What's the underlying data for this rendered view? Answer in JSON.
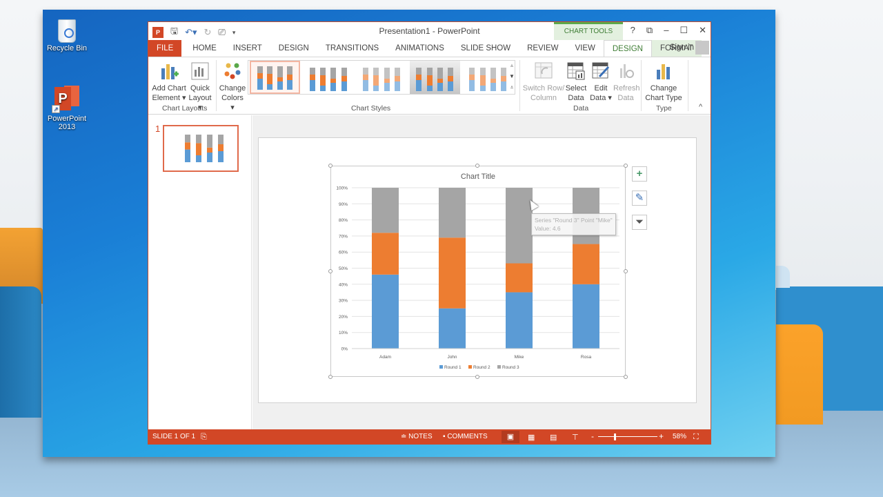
{
  "desktop": {
    "icons": [
      {
        "label": "Recycle Bin",
        "icon": "recycle-bin-icon"
      },
      {
        "label": "PowerPoint 2013",
        "icon": "powerpoint-icon"
      }
    ]
  },
  "window": {
    "title": "Presentation1 - PowerPoint",
    "contextual_tab_group": "CHART TOOLS",
    "qat": [
      "save-icon",
      "undo-icon",
      "redo-icon",
      "start-from-beginning-icon",
      "customize-qat-icon"
    ],
    "window_controls": {
      "help": "?",
      "restore_ribbon": "⧉",
      "minimize": "–",
      "maximize": "☐",
      "close": "✕"
    },
    "sign_in": "Sign in"
  },
  "tabs": [
    {
      "label": "FILE",
      "state": "file"
    },
    {
      "label": "HOME"
    },
    {
      "label": "INSERT"
    },
    {
      "label": "DESIGN"
    },
    {
      "label": "TRANSITIONS"
    },
    {
      "label": "ANIMATIONS"
    },
    {
      "label": "SLIDE SHOW"
    },
    {
      "label": "REVIEW"
    },
    {
      "label": "VIEW"
    },
    {
      "label": "DESIGN",
      "state": "active"
    },
    {
      "label": "FORMAT",
      "state": "contextual"
    }
  ],
  "ribbon": {
    "chart_layouts": {
      "group_label": "Chart Layouts",
      "add_chart_element": {
        "line1": "Add Chart",
        "line2": "Element ▾"
      },
      "quick_layout": {
        "line1": "Quick",
        "line2": "Layout ▾"
      }
    },
    "chart_styles": {
      "group_label": "Chart Styles",
      "change_colors": {
        "line1": "Change",
        "line2": "Colors ▾"
      },
      "selected_style_index": 0,
      "style_count_visible": 5
    },
    "data": {
      "group_label": "Data",
      "switch_row_column": {
        "line1": "Switch Row/",
        "line2": "Column",
        "enabled": false
      },
      "select_data": {
        "line1": "Select",
        "line2": "Data",
        "enabled": true
      },
      "edit_data": {
        "line1": "Edit",
        "line2": "Data ▾",
        "enabled": true
      },
      "refresh_data": {
        "line1": "Refresh",
        "line2": "Data",
        "enabled": false
      }
    },
    "type": {
      "group_label": "Type",
      "change_chart_type": {
        "line1": "Change",
        "line2": "Chart Type"
      }
    },
    "collapse": "^"
  },
  "thumbnails": [
    {
      "number": "1",
      "selected": true
    }
  ],
  "chart_data": {
    "type": "bar",
    "stacked": "percent",
    "title": "Chart Title",
    "categories": [
      "Adam",
      "John",
      "Mike",
      "Rosa"
    ],
    "series": [
      {
        "name": "Round 1",
        "color": "#5b9bd5",
        "percent": [
          46,
          25,
          35,
          40
        ]
      },
      {
        "name": "Round 2",
        "color": "#ed7d31",
        "percent": [
          26,
          44,
          18,
          25
        ]
      },
      {
        "name": "Round 3",
        "color": "#a5a5a5",
        "percent": [
          28,
          31,
          47,
          35
        ]
      }
    ],
    "yticks": [
      "0%",
      "10%",
      "20%",
      "30%",
      "40%",
      "50%",
      "60%",
      "70%",
      "80%",
      "90%",
      "100%"
    ],
    "ylim": [
      0,
      100
    ],
    "xlabel": "",
    "ylabel": "",
    "grid": true,
    "legend": "bottom"
  },
  "tooltip": {
    "line1": "Series \"Round 3\" Point \"Mike\"",
    "line2": "Value: 4.6"
  },
  "chart_side_buttons": [
    "chart-elements-plus-icon",
    "chart-styles-brush-icon",
    "chart-filters-funnel-icon"
  ],
  "status": {
    "slide_info": "SLIDE 1 OF 1",
    "notes": "NOTES",
    "comments": "COMMENTS",
    "zoom_percent": "58%",
    "zoom_level": 58
  }
}
